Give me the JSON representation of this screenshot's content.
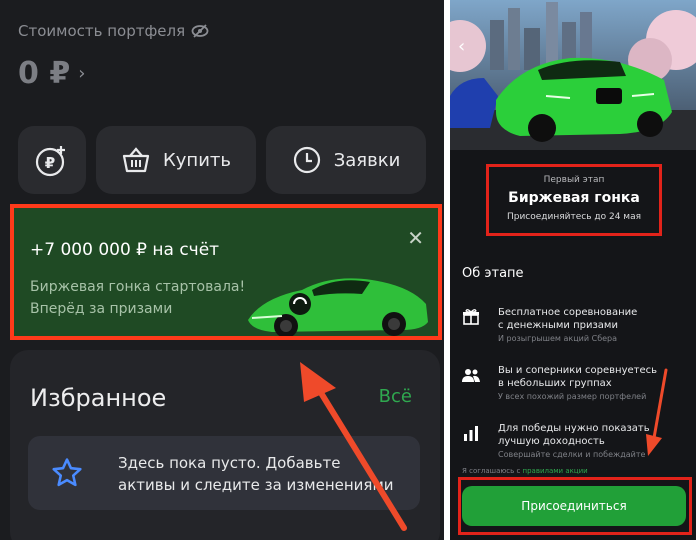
{
  "left": {
    "portfolio_label": "Стоимость портфеля",
    "portfolio_value": "0 ₽",
    "actions": [
      {
        "icon": "ruble-plus-icon",
        "label": ""
      },
      {
        "icon": "basket-icon",
        "label": "Купить"
      },
      {
        "icon": "clock-icon",
        "label": "Заявки"
      }
    ],
    "banner": {
      "title": "+7 000 000 ₽ на счёт",
      "subtitle_line1": "Биржевая гонка стартовала!",
      "subtitle_line2": "Вперёд за призами"
    },
    "favorites": {
      "title": "Избранное",
      "all_link": "Всё",
      "empty_line1": "Здесь пока пусто. Добавьте",
      "empty_line2": "активы и следите за изменениями"
    }
  },
  "right": {
    "stage": {
      "label": "Первый этап",
      "title": "Биржевая гонка",
      "deadline": "Присоединяйтесь до 24 мая"
    },
    "about_title": "Об этапе",
    "features": [
      {
        "icon": "gift-icon",
        "title_line1": "Бесплатное соревнование",
        "title_line2": "с денежными призами",
        "subtitle": "И розыгрышем акций Сбера"
      },
      {
        "icon": "users-icon",
        "title_line1": "Вы и соперники соревнуетесь",
        "title_line2": "в небольших группах",
        "subtitle": "У всех похожий размер портфелей"
      },
      {
        "icon": "bar-chart-icon",
        "title_line1": "Для победы нужно показать",
        "title_line2": "лучшую доходность",
        "subtitle": "Совершайте сделки и побеждайте"
      }
    ],
    "consent_prefix": "Я соглашаюсь с",
    "consent_link": "правилами акции",
    "join_button": "Присоединиться"
  },
  "colors": {
    "accent_green": "#21a038",
    "highlight_red": "#e2231a",
    "arrow_red": "#ef4a2a"
  }
}
